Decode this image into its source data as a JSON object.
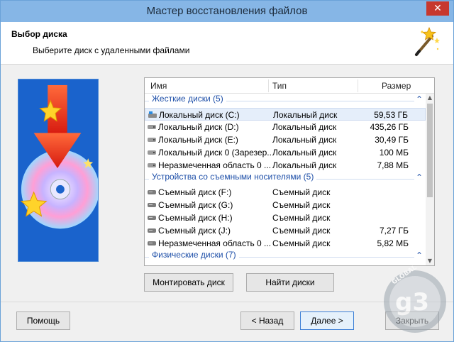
{
  "window": {
    "title": "Мастер восстановления файлов",
    "close_glyph": "✕"
  },
  "header": {
    "title": "Выбор диска",
    "subtitle": "Выберите диск с удаленными файлами",
    "icon": "magic-wand-icon"
  },
  "list": {
    "columns": {
      "name": "Имя",
      "type": "Тип",
      "size": "Размер"
    },
    "groups": [
      {
        "label": "Жесткие диски (5)",
        "expanded": true,
        "items": [
          {
            "name": "Локальный диск (C:)",
            "type": "Локальный диск",
            "size": "59,53 ГБ",
            "selected": true,
            "icon": "system-drive-icon"
          },
          {
            "name": "Локальный диск (D:)",
            "type": "Локальный диск",
            "size": "435,26 ГБ",
            "selected": false,
            "icon": "drive-icon"
          },
          {
            "name": "Локальный диск (E:)",
            "type": "Локальный диск",
            "size": "30,49 ГБ",
            "selected": false,
            "icon": "drive-icon"
          },
          {
            "name": "Локальный диск 0 (Зарезер...",
            "type": "Локальный диск",
            "size": "100 МБ",
            "selected": false,
            "icon": "drive-icon"
          },
          {
            "name": "Неразмеченная область 0 ...",
            "type": "Локальный диск",
            "size": "7,88 МБ",
            "selected": false,
            "icon": "drive-icon"
          }
        ]
      },
      {
        "label": "Устройства со съемными носителями (5)",
        "expanded": true,
        "items": [
          {
            "name": "Съемный диск (F:)",
            "type": "Съемный диск",
            "size": "",
            "selected": false,
            "icon": "removable-drive-icon"
          },
          {
            "name": "Съемный диск (G:)",
            "type": "Съемный диск",
            "size": "",
            "selected": false,
            "icon": "removable-drive-icon"
          },
          {
            "name": "Съемный диск (H:)",
            "type": "Съемный диск",
            "size": "",
            "selected": false,
            "icon": "removable-drive-icon"
          },
          {
            "name": "Съемный диск (J:)",
            "type": "Съемный диск",
            "size": "7,27 ГБ",
            "selected": false,
            "icon": "removable-drive-icon"
          },
          {
            "name": "Неразмеченная область 0 ...",
            "type": "Съемный диск",
            "size": "5,82 МБ",
            "selected": false,
            "icon": "removable-drive-icon"
          }
        ]
      },
      {
        "label": "Физические диски (7)",
        "expanded": true,
        "items": []
      }
    ]
  },
  "buttons": {
    "mount": "Монтировать диск",
    "find": "Найти диски",
    "help": "Помощь",
    "back": "< Назад",
    "next": "Далее >",
    "close": "Закрыть"
  },
  "colors": {
    "titlebar": "#86b6e6",
    "group_text": "#1e4fa8",
    "selection": "#e5eefa",
    "primary_border": "#3c7fd6"
  }
}
